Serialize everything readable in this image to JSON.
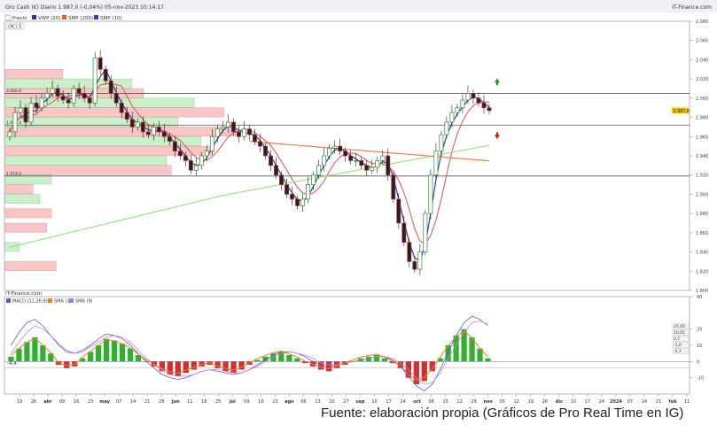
{
  "header": {
    "instrument": "Oro Cash (€) Diario 1.987,0 (-0,04%) 05-nov-2023 10:14:17",
    "brand": "IT-Finance.com",
    "price_tag": "Precio",
    "legend": [
      "VWP (20)",
      "SMP (200)",
      "SMP (10)"
    ],
    "legend_colors": [
      "#2233aa",
      "#e06020",
      "#3040c0"
    ],
    "period_box": "(9C) 5"
  },
  "colors": {
    "up_candle": "#2a8a2a",
    "down_candle": "#c03030",
    "fast_ma": "#2030b0",
    "slow_ma": "#e05050",
    "ma200": "#f07040",
    "long_ma": "#88e070",
    "profile_green": "#c5eec5",
    "profile_red": "#f8c0c0",
    "macd_blue": "#5060d0",
    "macd_pink": "#e080c0",
    "macd_orange": "#f08020"
  },
  "chart_data": [
    {
      "type": "candlestick",
      "title": "Oro Cash (€) Diario 1.987,0 (-0,04%) 05-nov-2023 10:14:17",
      "ylim": [
        1800,
        2080
      ],
      "y_ticks": [
        "2.080",
        "2.060",
        "2.040",
        "2.020",
        "2.000",
        "1.980",
        "1.960",
        "1.940",
        "1.920",
        "1.900",
        "1.880",
        "1.860",
        "1.840",
        "1.820",
        "1.800"
      ],
      "x_ticks": [
        "19",
        "26",
        "abr",
        "09",
        "16",
        "23",
        "may",
        "07",
        "14",
        "21",
        "28",
        "jun",
        "11",
        "18",
        "25",
        "jul",
        "09",
        "16",
        "23",
        "ago",
        "06",
        "13",
        "20",
        "27",
        "sep",
        "10",
        "17",
        "24",
        "oct",
        "08",
        "15",
        "22",
        "29",
        "nov",
        "05",
        "12",
        "19",
        "26",
        "dic",
        "10",
        "17",
        "24",
        "2024",
        "07",
        "14",
        "21",
        "feb",
        "11"
      ],
      "close_series": [
        1965,
        1985,
        1990,
        1975,
        1995,
        1990,
        2000,
        2005,
        2010,
        2002,
        1998,
        1995,
        2010,
        2005,
        2000,
        1995,
        2042,
        2030,
        2018,
        2005,
        1995,
        1985,
        1978,
        1970,
        1975,
        1965,
        1962,
        1970,
        1965,
        1960,
        1955,
        1945,
        1940,
        1935,
        1925,
        1930,
        1940,
        1945,
        1960,
        1968,
        1970,
        1975,
        1965,
        1960,
        1968,
        1962,
        1955,
        1950,
        1940,
        1930,
        1920,
        1910,
        1900,
        1895,
        1888,
        1895,
        1910,
        1920,
        1930,
        1940,
        1948,
        1950,
        1945,
        1940,
        1935,
        1935,
        1930,
        1925,
        1928,
        1935,
        1940,
        1920,
        1895,
        1870,
        1850,
        1830,
        1822,
        1840,
        1880,
        1920,
        1945,
        1962,
        1975,
        1985,
        1990,
        1998,
        2005,
        2000,
        1995,
        1990,
        1987
      ],
      "levels": [
        {
          "label": "2.000,0",
          "value": 2005
        },
        {
          "label": "1.977,0",
          "value": 1972
        },
        {
          "label": "1.918,0",
          "value": 1919
        }
      ],
      "price_marker": "1.987,0",
      "volume_profile": [
        {
          "price": 2025,
          "value": 0.25,
          "color": "red"
        },
        {
          "price": 2015,
          "value": 0.55,
          "color": "green"
        },
        {
          "price": 2005,
          "value": 0.6,
          "color": "red"
        },
        {
          "price": 1995,
          "value": 0.82,
          "color": "green"
        },
        {
          "price": 1985,
          "value": 0.95,
          "color": "red"
        },
        {
          "price": 1975,
          "value": 0.75,
          "color": "green"
        },
        {
          "price": 1965,
          "value": 1.0,
          "color": "red"
        },
        {
          "price": 1955,
          "value": 0.85,
          "color": "green"
        },
        {
          "price": 1945,
          "value": 0.9,
          "color": "red"
        },
        {
          "price": 1935,
          "value": 0.7,
          "color": "green"
        },
        {
          "price": 1925,
          "value": 0.72,
          "color": "red"
        },
        {
          "price": 1915,
          "value": 0.2,
          "color": "green"
        },
        {
          "price": 1905,
          "value": 0.12,
          "color": "red"
        },
        {
          "price": 1895,
          "value": 0.15,
          "color": "green"
        },
        {
          "price": 1880,
          "value": 0.2,
          "color": "red"
        },
        {
          "price": 1865,
          "value": 0.18,
          "color": "red"
        },
        {
          "price": 1845,
          "value": 0.06,
          "color": "green"
        },
        {
          "price": 1825,
          "value": 0.22,
          "color": "red"
        }
      ],
      "arrows": [
        {
          "direction": "up",
          "value": 2018,
          "color": "#2a8a2a"
        },
        {
          "direction": "down",
          "value": 1960,
          "color": "#d02020"
        }
      ]
    },
    {
      "type": "bar",
      "title": "MACD (12,26,9)",
      "source": "IT-Finance.com",
      "legend": [
        "MACD (12,26,9)",
        "SMA (1)",
        "SMA (9)"
      ],
      "ylim": [
        -20,
        40
      ],
      "y_ticks": [
        "40",
        "20",
        "10",
        "0",
        "-10"
      ],
      "histogram": [
        3,
        8,
        12,
        15,
        10,
        5,
        -2,
        -4,
        -3,
        2,
        6,
        10,
        14,
        13,
        11,
        8,
        4,
        0,
        -3,
        -6,
        -8,
        -9,
        -7,
        -5,
        -3,
        -2,
        -4,
        -6,
        -7,
        -5,
        -2,
        1,
        3,
        5,
        6,
        4,
        2,
        -1,
        -3,
        -5,
        -6,
        -4,
        -2,
        0,
        2,
        3,
        4,
        2,
        -1,
        -4,
        -10,
        -14,
        -12,
        -6,
        2,
        10,
        16,
        20,
        15,
        8,
        2
      ],
      "line_signal": [
        10,
        18,
        24,
        26,
        22,
        16,
        10,
        6,
        5,
        7,
        10,
        14,
        17,
        16,
        14,
        10,
        5,
        0,
        -4,
        -8,
        -10,
        -11,
        -10,
        -8,
        -6,
        -5,
        -6,
        -7,
        -8,
        -7,
        -5,
        -2,
        1,
        4,
        6,
        6,
        5,
        3,
        0,
        -2,
        -3,
        -2,
        -1,
        0,
        1,
        2,
        3,
        3,
        1,
        -3,
        -9,
        -15,
        -18,
        -14,
        -5,
        6,
        16,
        24,
        28,
        26,
        22
      ],
      "line_macd": [
        5,
        12,
        18,
        22,
        20,
        16,
        11,
        7,
        5,
        6,
        9,
        12,
        15,
        16,
        15,
        12,
        7,
        2,
        -2,
        -5,
        -8,
        -9,
        -9,
        -8,
        -6,
        -5,
        -5,
        -6,
        -7,
        -7,
        -5,
        -3,
        0,
        3,
        5,
        6,
        5,
        4,
        2,
        -1,
        -2,
        -2,
        -1,
        0,
        1,
        2,
        3,
        3,
        2,
        -1,
        -5,
        -10,
        -14,
        -13,
        -7,
        2,
        10,
        18,
        24,
        25,
        23
      ],
      "zero_level_label": "-4,4",
      "readouts": [
        "25,00",
        "20,01",
        "0,7",
        "-1,0",
        "-2,1"
      ]
    }
  ],
  "footer": {
    "caption": "Fuente: elaboración propia (Gráficos de Pro Real Time en IG)"
  }
}
